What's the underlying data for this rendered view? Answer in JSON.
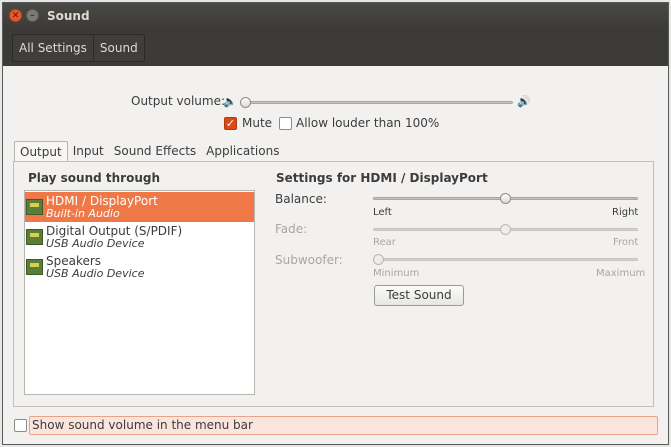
{
  "window": {
    "title": "Sound"
  },
  "toolbar": {
    "crumbs": [
      "All Settings",
      "Sound"
    ]
  },
  "output_volume": {
    "label": "Output volume:",
    "level": 0.0
  },
  "mute": {
    "label": "Mute",
    "checked": true
  },
  "allow_louder": {
    "label": "Allow louder than 100%",
    "checked": false
  },
  "tabs": [
    "Output",
    "Input",
    "Sound Effects",
    "Applications"
  ],
  "active_tab": "Output",
  "play_through": {
    "heading": "Play sound through",
    "devices": [
      {
        "name": "HDMI / DisplayPort",
        "type": "Built-in Audio",
        "selected": true
      },
      {
        "name": "Digital Output (S/PDIF)",
        "type": "USB Audio Device",
        "selected": false
      },
      {
        "name": "Speakers",
        "type": "USB Audio Device",
        "selected": false
      }
    ]
  },
  "settings": {
    "heading": "Settings for HDMI / DisplayPort",
    "balance": {
      "label": "Balance:",
      "left": "Left",
      "right": "Right",
      "value": 0.5
    },
    "fade": {
      "label": "Fade:",
      "left": "Rear",
      "right": "Front",
      "value": 0.5
    },
    "subwoofer": {
      "label": "Subwoofer:",
      "left": "Minimum",
      "right": "Maximum",
      "value": 0.0
    },
    "test_button": "Test Sound"
  },
  "menu_bar_option": {
    "label": "Show sound volume in the menu bar",
    "checked": false
  },
  "colors": {
    "accent": "#dd4814",
    "selection": "#f07746",
    "titlebar": "#3c3b37"
  }
}
